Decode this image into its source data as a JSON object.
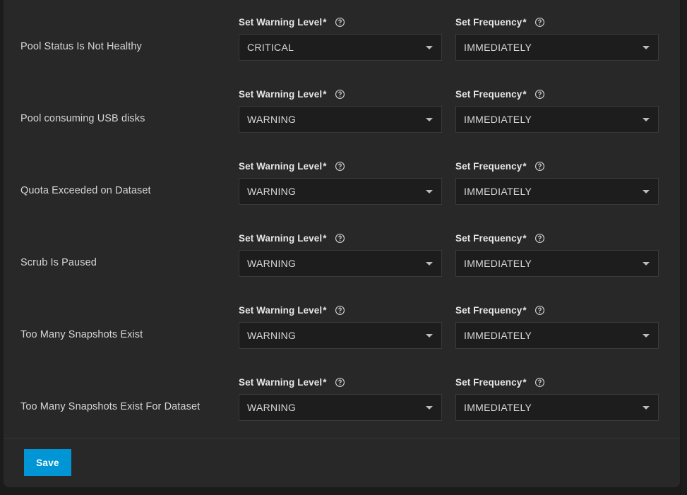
{
  "page": {
    "background_color": "#1b1b1b",
    "card_background_color": "#282828"
  },
  "columns": {
    "warning_level": {
      "label": "Set Warning Level",
      "required_mark": "*",
      "help_icon": "help-circle-icon"
    },
    "frequency": {
      "label": "Set Frequency",
      "required_mark": "*",
      "help_icon": "help-circle-icon"
    }
  },
  "rows": [
    {
      "name": "Pool Status Is Not Healthy",
      "warning_level": "CRITICAL",
      "frequency": "IMMEDIATELY"
    },
    {
      "name": "Pool consuming USB disks",
      "warning_level": "WARNING",
      "frequency": "IMMEDIATELY"
    },
    {
      "name": "Quota Exceeded on Dataset",
      "warning_level": "WARNING",
      "frequency": "IMMEDIATELY"
    },
    {
      "name": "Scrub Is Paused",
      "warning_level": "WARNING",
      "frequency": "IMMEDIATELY"
    },
    {
      "name": "Too Many Snapshots Exist",
      "warning_level": "WARNING",
      "frequency": "IMMEDIATELY"
    },
    {
      "name": "Too Many Snapshots Exist For Dataset",
      "warning_level": "WARNING",
      "frequency": "IMMEDIATELY"
    }
  ],
  "actions": {
    "save_label": "Save",
    "save_color": "#0095d5"
  }
}
